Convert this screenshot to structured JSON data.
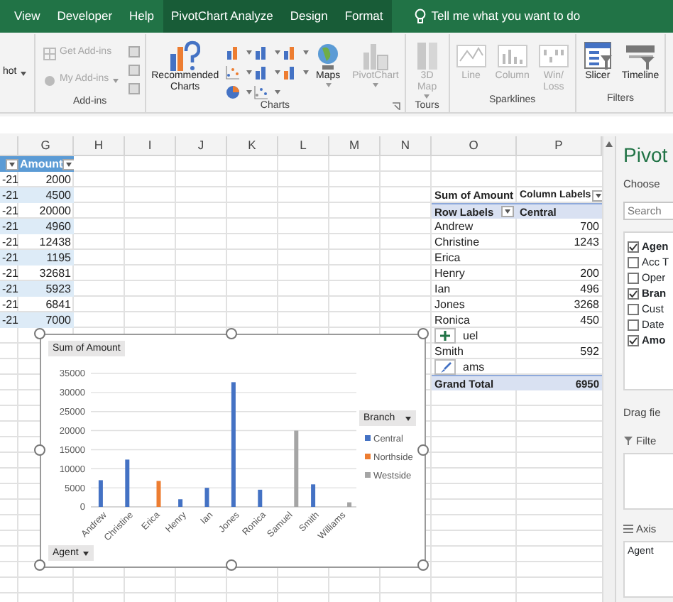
{
  "ribbon_tabs": [
    {
      "label": "View",
      "contextual": false
    },
    {
      "label": "Developer",
      "contextual": false
    },
    {
      "label": "Help",
      "contextual": false
    },
    {
      "label": "PivotChart Analyze",
      "contextual": true
    },
    {
      "label": "Design",
      "contextual": true
    },
    {
      "label": "Format",
      "contextual": true
    }
  ],
  "tell_me": {
    "placeholder": "Tell me what you want to do"
  },
  "ribbon": {
    "cut_item": {
      "label": "hot",
      "dropdown": true
    },
    "groups": [
      {
        "label": "Add-ins",
        "launcher": false,
        "items": [
          {
            "kind": "small",
            "label": "Get Add-ins",
            "disabled": true,
            "dropdown": false
          },
          {
            "kind": "small",
            "label": "My Add-ins",
            "disabled": true,
            "dropdown": true
          },
          {
            "kind": "icons"
          }
        ]
      },
      {
        "label": "Charts",
        "launcher": true,
        "items": [
          {
            "kind": "large",
            "label": "Recommended Charts",
            "disabled": false,
            "dropdown": false
          },
          {
            "kind": "gallery"
          },
          {
            "kind": "large",
            "label": "Maps",
            "disabled": false,
            "dropdown": true
          },
          {
            "kind": "large",
            "label": "PivotChart",
            "disabled": true,
            "dropdown": true
          }
        ]
      },
      {
        "label": "Tours",
        "launcher": false,
        "items": [
          {
            "kind": "large",
            "label": "3D Map",
            "disabled": true,
            "dropdown": true
          }
        ]
      },
      {
        "label": "Sparklines",
        "launcher": false,
        "items": [
          {
            "kind": "large",
            "label": "Line",
            "disabled": true,
            "dropdown": false
          },
          {
            "kind": "large",
            "label": "Column",
            "disabled": true,
            "dropdown": false
          },
          {
            "kind": "large",
            "label": "Win/ Loss",
            "disabled": true,
            "dropdown": false
          }
        ]
      },
      {
        "label": "Filters",
        "launcher": false,
        "items": [
          {
            "kind": "large",
            "label": "Slicer",
            "disabled": false,
            "dropdown": false
          },
          {
            "kind": "large",
            "label": "Timeline",
            "disabled": false,
            "dropdown": false
          }
        ]
      }
    ]
  },
  "sheet": {
    "columns": [
      "G",
      "H",
      "I",
      "J",
      "K",
      "L",
      "M",
      "N",
      "O",
      "P"
    ],
    "table": {
      "header": "Amount",
      "rows": [
        {
          "column_f": "-21",
          "amount": "2000"
        },
        {
          "column_f": "-21",
          "amount": "4500"
        },
        {
          "column_f": "-21",
          "amount": "20000"
        },
        {
          "column_f": "-21",
          "amount": "4960"
        },
        {
          "column_f": "-21",
          "amount": "12438"
        },
        {
          "column_f": "-21",
          "amount": "1195"
        },
        {
          "column_f": "-21",
          "amount": "32681"
        },
        {
          "column_f": "-21",
          "amount": "5923"
        },
        {
          "column_f": "-21",
          "amount": "6841"
        },
        {
          "column_f": "-21",
          "amount": "7000"
        }
      ]
    },
    "pivot": {
      "header": [
        "Sum of Amount",
        "Column Labels"
      ],
      "subheader": [
        "Row Labels",
        "Central"
      ],
      "rows": [
        {
          "label": "Andrew",
          "value": "700",
          "hidden_by_button": false
        },
        {
          "label": "Christine",
          "value": "1243",
          "hidden_by_button": false
        },
        {
          "label": "Erica",
          "hidden_by_button": false
        },
        {
          "label": "Henry",
          "value": "200",
          "hidden_by_button": false
        },
        {
          "label": "Ian",
          "value": "496",
          "hidden_by_button": false
        },
        {
          "label": "Jones",
          "value": "3268",
          "hidden_by_button": false
        },
        {
          "label": "Ronica",
          "value": "450",
          "hidden_by_button": false
        },
        {
          "label": "uel",
          "hidden_by_button": true
        },
        {
          "label": "Smith",
          "value": "592",
          "hidden_by_button": false
        },
        {
          "label": "ams",
          "hidden_by_button": true
        }
      ],
      "total": [
        "Grand Total",
        "6950"
      ]
    }
  },
  "pivot_chart": {
    "value_button": "Sum of Amount",
    "legend_button": "Branch",
    "axis_button": "Agent",
    "chart_data": {
      "type": "bar",
      "categories": [
        "Andrew",
        "Christine",
        "Erica",
        "Henry",
        "Ian",
        "Jones",
        "Ronica",
        "Samuel",
        "Smith",
        "Williams"
      ],
      "series": [
        {
          "name": "Central",
          "color": "#4472c4",
          "values": [
            7000,
            12400,
            null,
            2000,
            5000,
            32700,
            4500,
            null,
            5900,
            null
          ]
        },
        {
          "name": "Northside",
          "color": "#ed7d31",
          "values": [
            null,
            null,
            6800,
            null,
            null,
            null,
            null,
            null,
            null,
            null
          ]
        },
        {
          "name": "Westside",
          "color": "#a5a5a5",
          "values": [
            null,
            null,
            null,
            null,
            null,
            null,
            null,
            20000,
            null,
            1200
          ]
        }
      ],
      "ylim": [
        0,
        35000
      ],
      "yticks": [
        0,
        5000,
        10000,
        15000,
        20000,
        25000,
        30000,
        35000
      ],
      "grid": true,
      "legend": true
    }
  },
  "field_pane": {
    "title": "Pivot",
    "subtitle": "Choose",
    "search_placeholder": "Search",
    "fields": [
      {
        "label": "Agen",
        "checked": true
      },
      {
        "label": "Acc T",
        "checked": false
      },
      {
        "label": "Oper",
        "checked": false
      },
      {
        "label": "Bran",
        "checked": true
      },
      {
        "label": "Cust",
        "checked": false
      },
      {
        "label": "Date",
        "checked": false
      },
      {
        "label": "Amo",
        "checked": true
      }
    ],
    "drag_hint": "Drag fie",
    "areas": [
      {
        "kind": "filters",
        "label": "Filte"
      },
      {
        "kind": "axis",
        "label": "Axis",
        "items": [
          "Agent"
        ]
      }
    ]
  }
}
